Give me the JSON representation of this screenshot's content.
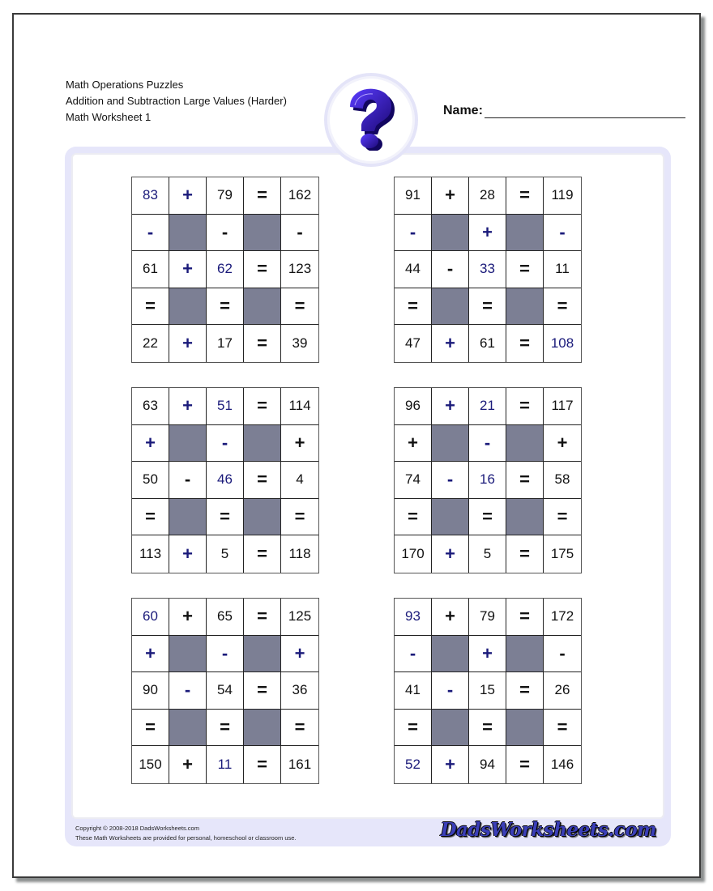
{
  "header": {
    "lines": [
      "Math Operations Puzzles",
      "Addition and Subtraction Large Values (Harder)",
      "Math Worksheet 1"
    ],
    "name_label": "Name:",
    "logo_icon": "question-mark-icon"
  },
  "puzzles": [
    {
      "rows": [
        [
          {
            "t": "83",
            "c": "blue"
          },
          {
            "t": "+",
            "c": "blue"
          },
          {
            "t": "79"
          },
          {
            "t": "="
          },
          {
            "t": "162"
          }
        ],
        [
          {
            "t": "-",
            "c": "blue"
          },
          {
            "t": "",
            "shade": true
          },
          {
            "t": "-"
          },
          {
            "t": "",
            "shade": true
          },
          {
            "t": "-"
          }
        ],
        [
          {
            "t": "61"
          },
          {
            "t": "+",
            "c": "blue"
          },
          {
            "t": "62",
            "c": "blue"
          },
          {
            "t": "="
          },
          {
            "t": "123"
          }
        ],
        [
          {
            "t": "="
          },
          {
            "t": "",
            "shade": true
          },
          {
            "t": "="
          },
          {
            "t": "",
            "shade": true
          },
          {
            "t": "="
          }
        ],
        [
          {
            "t": "22"
          },
          {
            "t": "+",
            "c": "blue"
          },
          {
            "t": "17"
          },
          {
            "t": "="
          },
          {
            "t": "39"
          }
        ]
      ]
    },
    {
      "rows": [
        [
          {
            "t": "91"
          },
          {
            "t": "+"
          },
          {
            "t": "28"
          },
          {
            "t": "="
          },
          {
            "t": "119"
          }
        ],
        [
          {
            "t": "-",
            "c": "blue"
          },
          {
            "t": "",
            "shade": true
          },
          {
            "t": "+",
            "c": "blue"
          },
          {
            "t": "",
            "shade": true
          },
          {
            "t": "-",
            "c": "blue"
          }
        ],
        [
          {
            "t": "44"
          },
          {
            "t": "-"
          },
          {
            "t": "33",
            "c": "blue"
          },
          {
            "t": "="
          },
          {
            "t": "11"
          }
        ],
        [
          {
            "t": "="
          },
          {
            "t": "",
            "shade": true
          },
          {
            "t": "="
          },
          {
            "t": "",
            "shade": true
          },
          {
            "t": "="
          }
        ],
        [
          {
            "t": "47"
          },
          {
            "t": "+",
            "c": "blue"
          },
          {
            "t": "61"
          },
          {
            "t": "="
          },
          {
            "t": "108",
            "c": "blue"
          }
        ]
      ]
    },
    {
      "rows": [
        [
          {
            "t": "63"
          },
          {
            "t": "+",
            "c": "blue"
          },
          {
            "t": "51",
            "c": "blue"
          },
          {
            "t": "="
          },
          {
            "t": "114"
          }
        ],
        [
          {
            "t": "+",
            "c": "blue"
          },
          {
            "t": "",
            "shade": true
          },
          {
            "t": "-",
            "c": "blue"
          },
          {
            "t": "",
            "shade": true
          },
          {
            "t": "+"
          }
        ],
        [
          {
            "t": "50"
          },
          {
            "t": "-"
          },
          {
            "t": "46",
            "c": "blue"
          },
          {
            "t": "="
          },
          {
            "t": "4"
          }
        ],
        [
          {
            "t": "="
          },
          {
            "t": "",
            "shade": true
          },
          {
            "t": "="
          },
          {
            "t": "",
            "shade": true
          },
          {
            "t": "="
          }
        ],
        [
          {
            "t": "113"
          },
          {
            "t": "+",
            "c": "blue"
          },
          {
            "t": "5"
          },
          {
            "t": "="
          },
          {
            "t": "118"
          }
        ]
      ]
    },
    {
      "rows": [
        [
          {
            "t": "96"
          },
          {
            "t": "+",
            "c": "blue"
          },
          {
            "t": "21",
            "c": "blue"
          },
          {
            "t": "="
          },
          {
            "t": "117"
          }
        ],
        [
          {
            "t": "+"
          },
          {
            "t": "",
            "shade": true
          },
          {
            "t": "-",
            "c": "blue"
          },
          {
            "t": "",
            "shade": true
          },
          {
            "t": "+"
          }
        ],
        [
          {
            "t": "74"
          },
          {
            "t": "-",
            "c": "blue"
          },
          {
            "t": "16",
            "c": "blue"
          },
          {
            "t": "="
          },
          {
            "t": "58"
          }
        ],
        [
          {
            "t": "="
          },
          {
            "t": "",
            "shade": true
          },
          {
            "t": "="
          },
          {
            "t": "",
            "shade": true
          },
          {
            "t": "="
          }
        ],
        [
          {
            "t": "170"
          },
          {
            "t": "+",
            "c": "blue"
          },
          {
            "t": "5"
          },
          {
            "t": "="
          },
          {
            "t": "175"
          }
        ]
      ]
    },
    {
      "rows": [
        [
          {
            "t": "60",
            "c": "blue"
          },
          {
            "t": "+"
          },
          {
            "t": "65"
          },
          {
            "t": "="
          },
          {
            "t": "125"
          }
        ],
        [
          {
            "t": "+",
            "c": "blue"
          },
          {
            "t": "",
            "shade": true
          },
          {
            "t": "-",
            "c": "blue"
          },
          {
            "t": "",
            "shade": true
          },
          {
            "t": "+",
            "c": "blue"
          }
        ],
        [
          {
            "t": "90"
          },
          {
            "t": "-",
            "c": "blue"
          },
          {
            "t": "54"
          },
          {
            "t": "="
          },
          {
            "t": "36"
          }
        ],
        [
          {
            "t": "="
          },
          {
            "t": "",
            "shade": true
          },
          {
            "t": "="
          },
          {
            "t": "",
            "shade": true
          },
          {
            "t": "="
          }
        ],
        [
          {
            "t": "150"
          },
          {
            "t": "+"
          },
          {
            "t": "11",
            "c": "blue"
          },
          {
            "t": "="
          },
          {
            "t": "161"
          }
        ]
      ]
    },
    {
      "rows": [
        [
          {
            "t": "93",
            "c": "blue"
          },
          {
            "t": "+"
          },
          {
            "t": "79"
          },
          {
            "t": "="
          },
          {
            "t": "172"
          }
        ],
        [
          {
            "t": "-",
            "c": "blue"
          },
          {
            "t": "",
            "shade": true
          },
          {
            "t": "+",
            "c": "blue"
          },
          {
            "t": "",
            "shade": true
          },
          {
            "t": "-"
          }
        ],
        [
          {
            "t": "41"
          },
          {
            "t": "-",
            "c": "blue"
          },
          {
            "t": "15"
          },
          {
            "t": "="
          },
          {
            "t": "26"
          }
        ],
        [
          {
            "t": "="
          },
          {
            "t": "",
            "shade": true
          },
          {
            "t": "="
          },
          {
            "t": "",
            "shade": true
          },
          {
            "t": "="
          }
        ],
        [
          {
            "t": "52",
            "c": "blue"
          },
          {
            "t": "+",
            "c": "blue"
          },
          {
            "t": "94"
          },
          {
            "t": "="
          },
          {
            "t": "146"
          }
        ]
      ]
    }
  ],
  "footer": {
    "copyright": "Copyright © 2008-2018 DadsWorksheets.com",
    "usage": "These Math Worksheets are provided for personal, homeschool or classroom use.",
    "brand": "DadsWorksheets.com"
  },
  "colors": {
    "answer_blue": "#1a1a7a",
    "shaded_cell": "#7c7f94",
    "frame_lavender": "#e6e6fa"
  }
}
